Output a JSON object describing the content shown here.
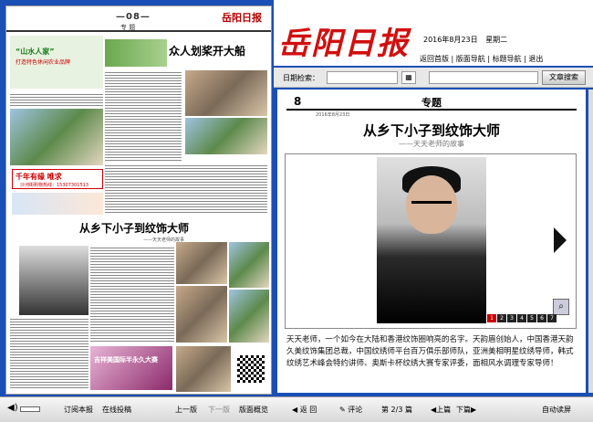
{
  "paper": {
    "page_no": "—08—",
    "section": "专 题",
    "logo": "岳阳日报",
    "ad_title": "“山水人家”",
    "ad_sub": "打造特色休闲农业品牌",
    "headline1": "众人划桨开大船",
    "headline2": "从乡下小子到纹饰大师",
    "headline2_sub": "——天天老师的故事",
    "ad_red_title": "千年有缘  唯求",
    "ad_red_sub": "沙河街购物热线：15307301513",
    "bottom_ad": "吉祥美国际半永久大赛"
  },
  "header": {
    "logo": "岳阳日报",
    "date": "2016年8月23日",
    "weekday": "星期二",
    "nav": [
      "返回首版",
      "版面导航",
      "标题导航",
      "退出"
    ]
  },
  "search": {
    "label": "日期检索：",
    "button": "文章搜索",
    "calendar_icon": "calendar-icon"
  },
  "article": {
    "page_no": "8",
    "section": "专题",
    "meta": "2016年8月23日",
    "title": "从乡下小子到纹饰大师",
    "subtitle": "——天天老师的故事",
    "pages": [
      "1",
      "2",
      "3",
      "4",
      "5",
      "6",
      "7"
    ],
    "current_page": "1",
    "body": "天天老师，一个如今在大陆和香港纹饰圈响亮的名字。天韵眉创始人，中国香港天韵久美纹饰集团总裁，中国纹绣师平台百万俱乐部师队，亚洲美相明星纹绣导师，韩式纹绣艺术峰会特约讲师、奥斯卡杯纹绣大赛专家评委，面相风水调理专家导师！"
  },
  "left_bar": {
    "items": [
      "订阅本报",
      "在线投稿",
      "上一版",
      "下一版",
      "版面概览"
    ]
  },
  "right_bar": {
    "back": "返 回",
    "comment": "评论",
    "page_label": "第",
    "page_value": "2/3",
    "page_unit": "篇",
    "prev": "上篇",
    "next": "下篇",
    "auto": "自动读屏"
  }
}
